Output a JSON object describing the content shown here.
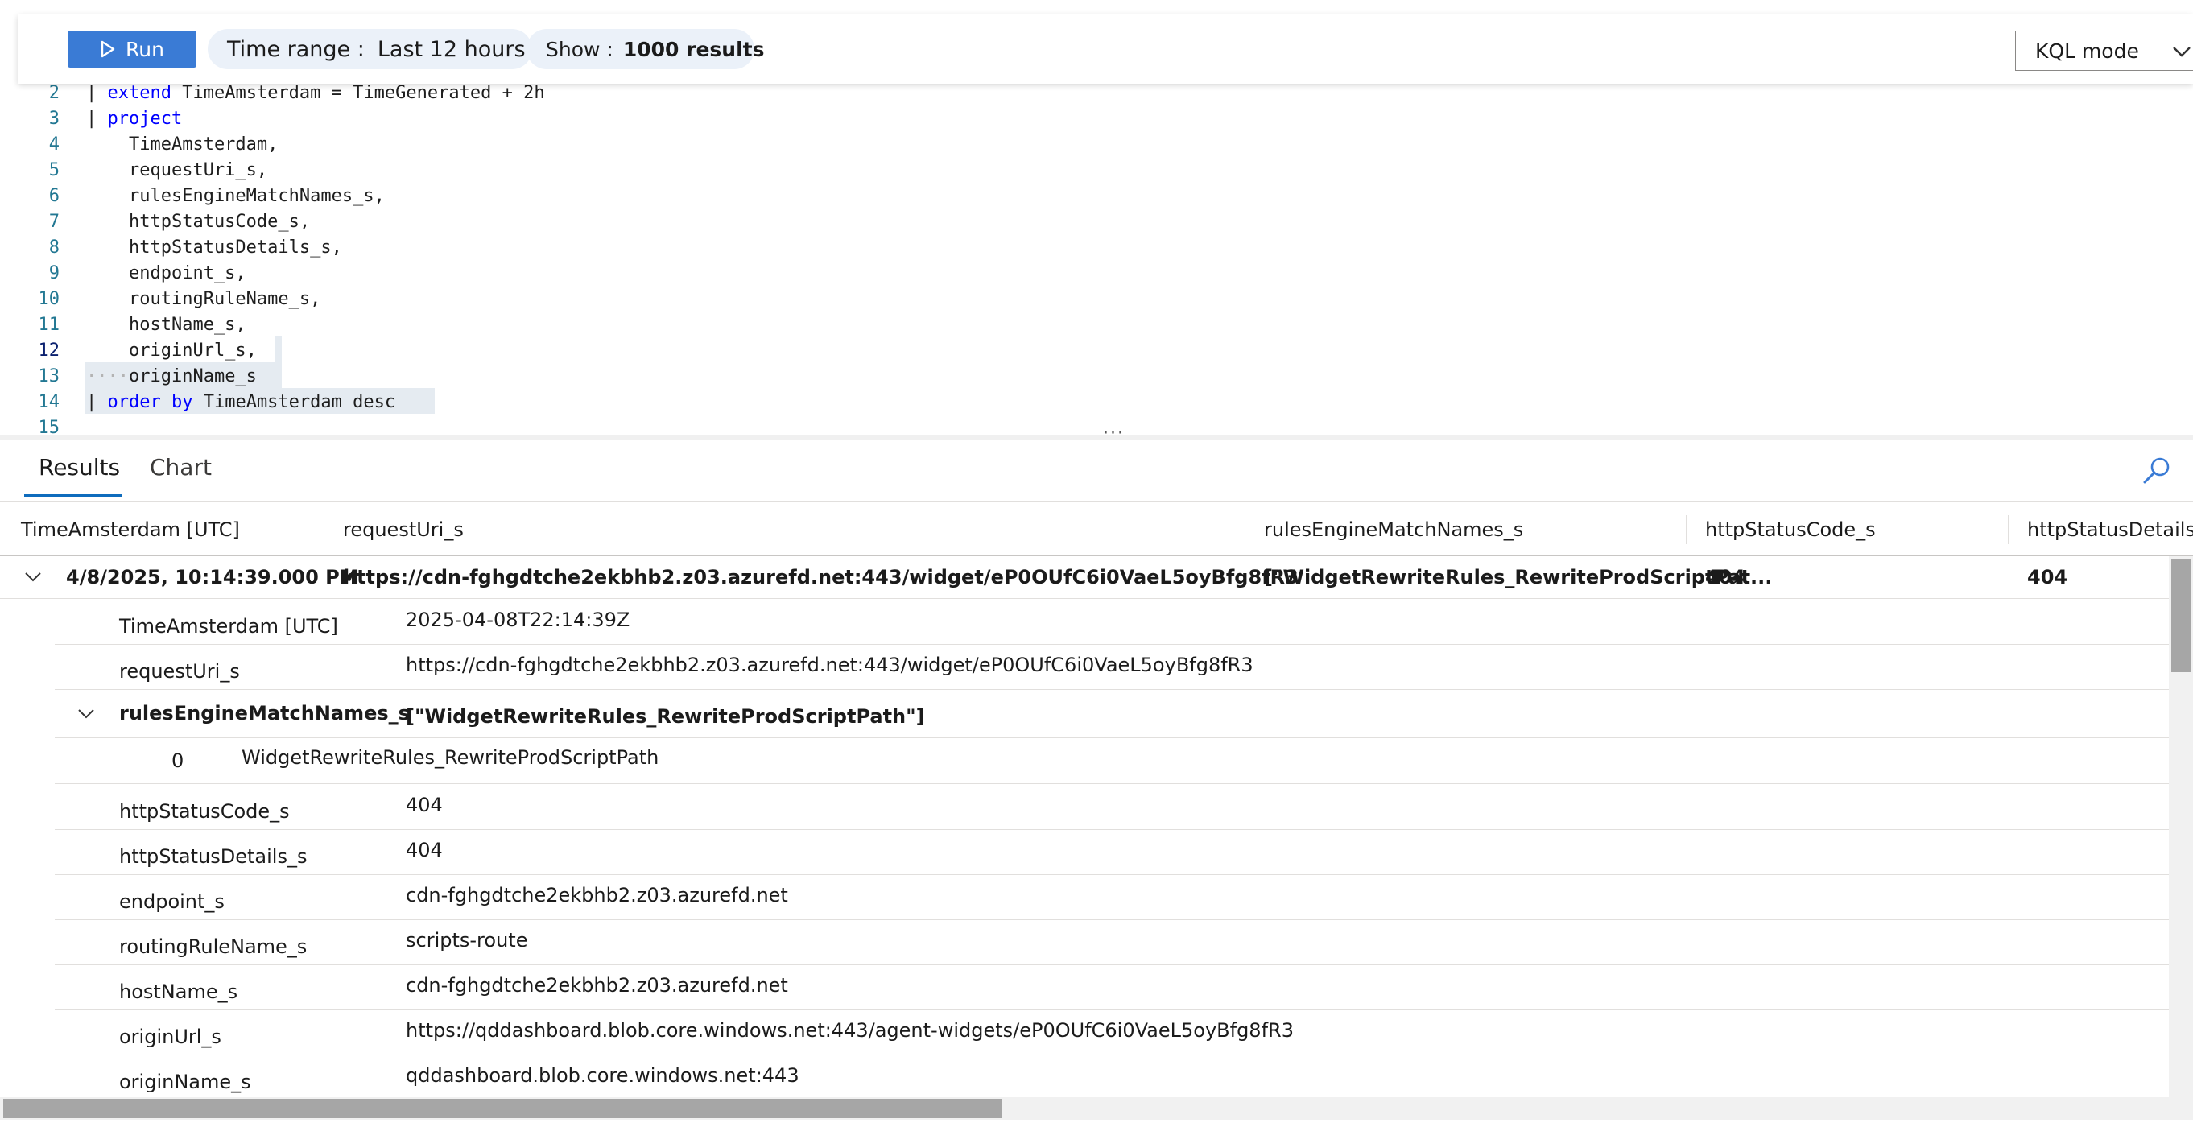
{
  "toolbar": {
    "run_label": "Run",
    "time_range_label": "Time range :",
    "time_range_value": "Last 12 hours",
    "show_label": "Show :",
    "show_value": "1000 results",
    "mode_label": "KQL mode"
  },
  "editor": {
    "lines": [
      {
        "num": "2",
        "parts": [
          [
            "op",
            "| "
          ],
          [
            "kw",
            "extend"
          ],
          [
            "t",
            " TimeAmsterdam = TimeGenerated + 2h"
          ]
        ]
      },
      {
        "num": "3",
        "parts": [
          [
            "op",
            "| "
          ],
          [
            "kw",
            "project"
          ]
        ]
      },
      {
        "num": "4",
        "parts": [
          [
            "t",
            "    TimeAmsterdam,"
          ]
        ]
      },
      {
        "num": "5",
        "parts": [
          [
            "t",
            "    requestUri_s,"
          ]
        ]
      },
      {
        "num": "6",
        "parts": [
          [
            "t",
            "    rulesEngineMatchNames_s,"
          ]
        ]
      },
      {
        "num": "7",
        "parts": [
          [
            "t",
            "    httpStatusCode_s,"
          ]
        ]
      },
      {
        "num": "8",
        "parts": [
          [
            "t",
            "    httpStatusDetails_s,"
          ]
        ]
      },
      {
        "num": "9",
        "parts": [
          [
            "t",
            "    endpoint_s,"
          ]
        ]
      },
      {
        "num": "10",
        "parts": [
          [
            "t",
            "    routingRuleName_s,"
          ]
        ]
      },
      {
        "num": "11",
        "parts": [
          [
            "t",
            "    hostName_s,"
          ]
        ]
      },
      {
        "num": "12",
        "parts": [
          [
            "t",
            "    originUrl_s,"
          ]
        ]
      },
      {
        "num": "13",
        "parts": [
          [
            "ws",
            "····"
          ],
          [
            "t",
            "originName_s"
          ]
        ]
      },
      {
        "num": "14",
        "parts": [
          [
            "op",
            "| "
          ],
          [
            "kw",
            "order by"
          ],
          [
            "t",
            " TimeAmsterdam desc"
          ]
        ]
      },
      {
        "num": "15",
        "parts": []
      }
    ],
    "active_line": "12"
  },
  "tabs": [
    "Results",
    "Chart"
  ],
  "grid": {
    "columns": [
      "TimeAmsterdam [UTC]",
      "requestUri_s",
      "rulesEngineMatchNames_s",
      "httpStatusCode_s",
      "httpStatusDetails_s"
    ],
    "row": {
      "time": "4/8/2025, 10:14:39.000 PM",
      "request_uri": "https://cdn-fghgdtche2ekbhb2.z03.azurefd.net:443/widget/eP0OUfC6i0VaeL5oyBfg8fR3",
      "rules": "[\"WidgetRewriteRules_RewriteProdScriptPat...",
      "status_code": "404",
      "status_details": "404"
    },
    "details": [
      {
        "key": "TimeAmsterdam [UTC]",
        "value": "2025-04-08T22:14:39Z"
      },
      {
        "key": "requestUri_s",
        "value": "https://cdn-fghgdtche2ekbhb2.z03.azurefd.net:443/widget/eP0OUfC6i0VaeL5oyBfg8fR3"
      },
      {
        "key": "rulesEngineMatchNames_s",
        "value": "[\"WidgetRewriteRules_RewriteProdScriptPath\"]",
        "expanded": true,
        "sub": [
          {
            "index": "0",
            "value": "WidgetRewriteRules_RewriteProdScriptPath"
          }
        ]
      },
      {
        "key": "httpStatusCode_s",
        "value": "404"
      },
      {
        "key": "httpStatusDetails_s",
        "value": "404"
      },
      {
        "key": "endpoint_s",
        "value": "cdn-fghgdtche2ekbhb2.z03.azurefd.net"
      },
      {
        "key": "routingRuleName_s",
        "value": "scripts-route"
      },
      {
        "key": "hostName_s",
        "value": "cdn-fghgdtche2ekbhb2.z03.azurefd.net"
      },
      {
        "key": "originUrl_s",
        "value": "https://qddashboard.blob.core.windows.net:443/agent-widgets/eP0OUfC6i0VaeL5oyBfg8fR3"
      },
      {
        "key": "originName_s",
        "value": "qddashboard.blob.core.windows.net:443"
      }
    ]
  },
  "colors": {
    "accent": "#3a7bd5",
    "keyword": "#0000ff",
    "line_number": "#237893"
  }
}
